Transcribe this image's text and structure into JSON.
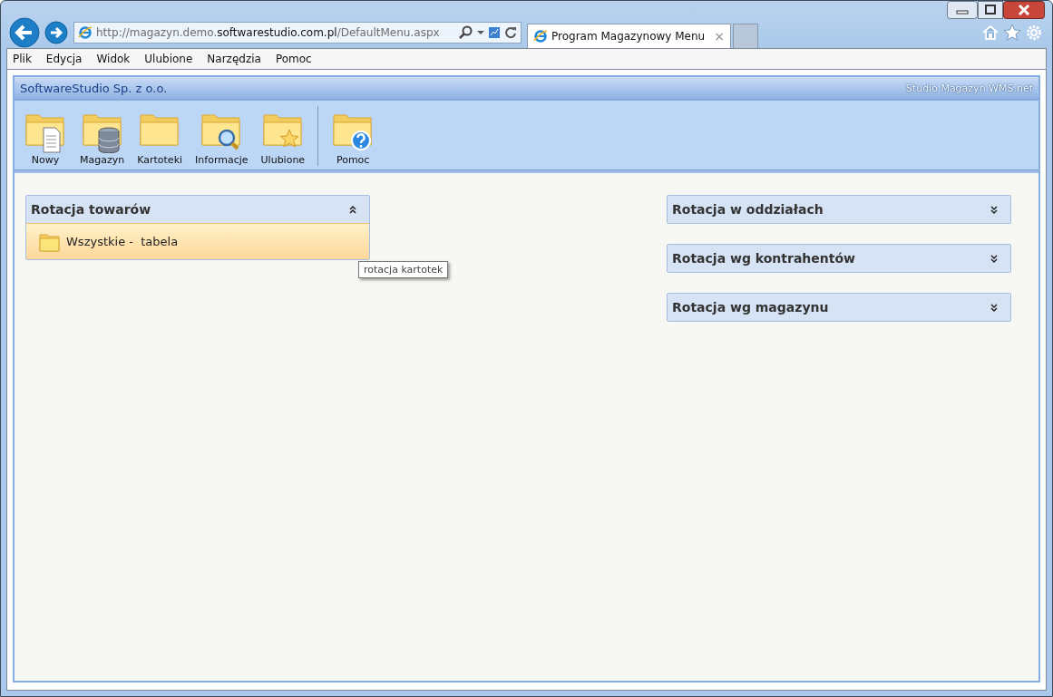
{
  "browser": {
    "address": {
      "prefix": "http://magazyn.demo.",
      "domain": "softwarestudio.com.pl",
      "path": "/DefaultMenu.aspx"
    },
    "tabs": [
      {
        "title": "Program Magazynowy Menu",
        "selected": true,
        "close": "×"
      }
    ],
    "menu": [
      "Plik",
      "Edycja",
      "Widok",
      "Ulubione",
      "Narzędzia",
      "Pomoc"
    ]
  },
  "app": {
    "company": "SoftwareStudio Sp. z o.o.",
    "product": "Studio Magazyn WMS.net",
    "toolbar": [
      {
        "label": "Nowy",
        "kind": "document",
        "separator_before": false
      },
      {
        "label": "Magazyn",
        "kind": "database",
        "separator_before": false
      },
      {
        "label": "Kartoteki",
        "kind": "plain",
        "separator_before": false
      },
      {
        "label": "Informacje",
        "kind": "search",
        "separator_before": false
      },
      {
        "label": "Ulubione",
        "kind": "star",
        "separator_before": false
      },
      {
        "label": "Pomoc",
        "kind": "help",
        "separator_before": true
      }
    ],
    "columns": [
      [
        {
          "title": "Rotacja towarów",
          "expanded": true,
          "items": [
            {
              "label": "Wszystkie -  tabela",
              "selected": true
            }
          ]
        }
      ],
      [
        {
          "title": "Rotacja w oddziałach",
          "expanded": false
        },
        {
          "title": "Rotacja wg kontrahentów",
          "expanded": false
        },
        {
          "title": "Rotacja wg magazynu",
          "expanded": false
        }
      ]
    ],
    "tooltip": "rotacja kartotek"
  }
}
